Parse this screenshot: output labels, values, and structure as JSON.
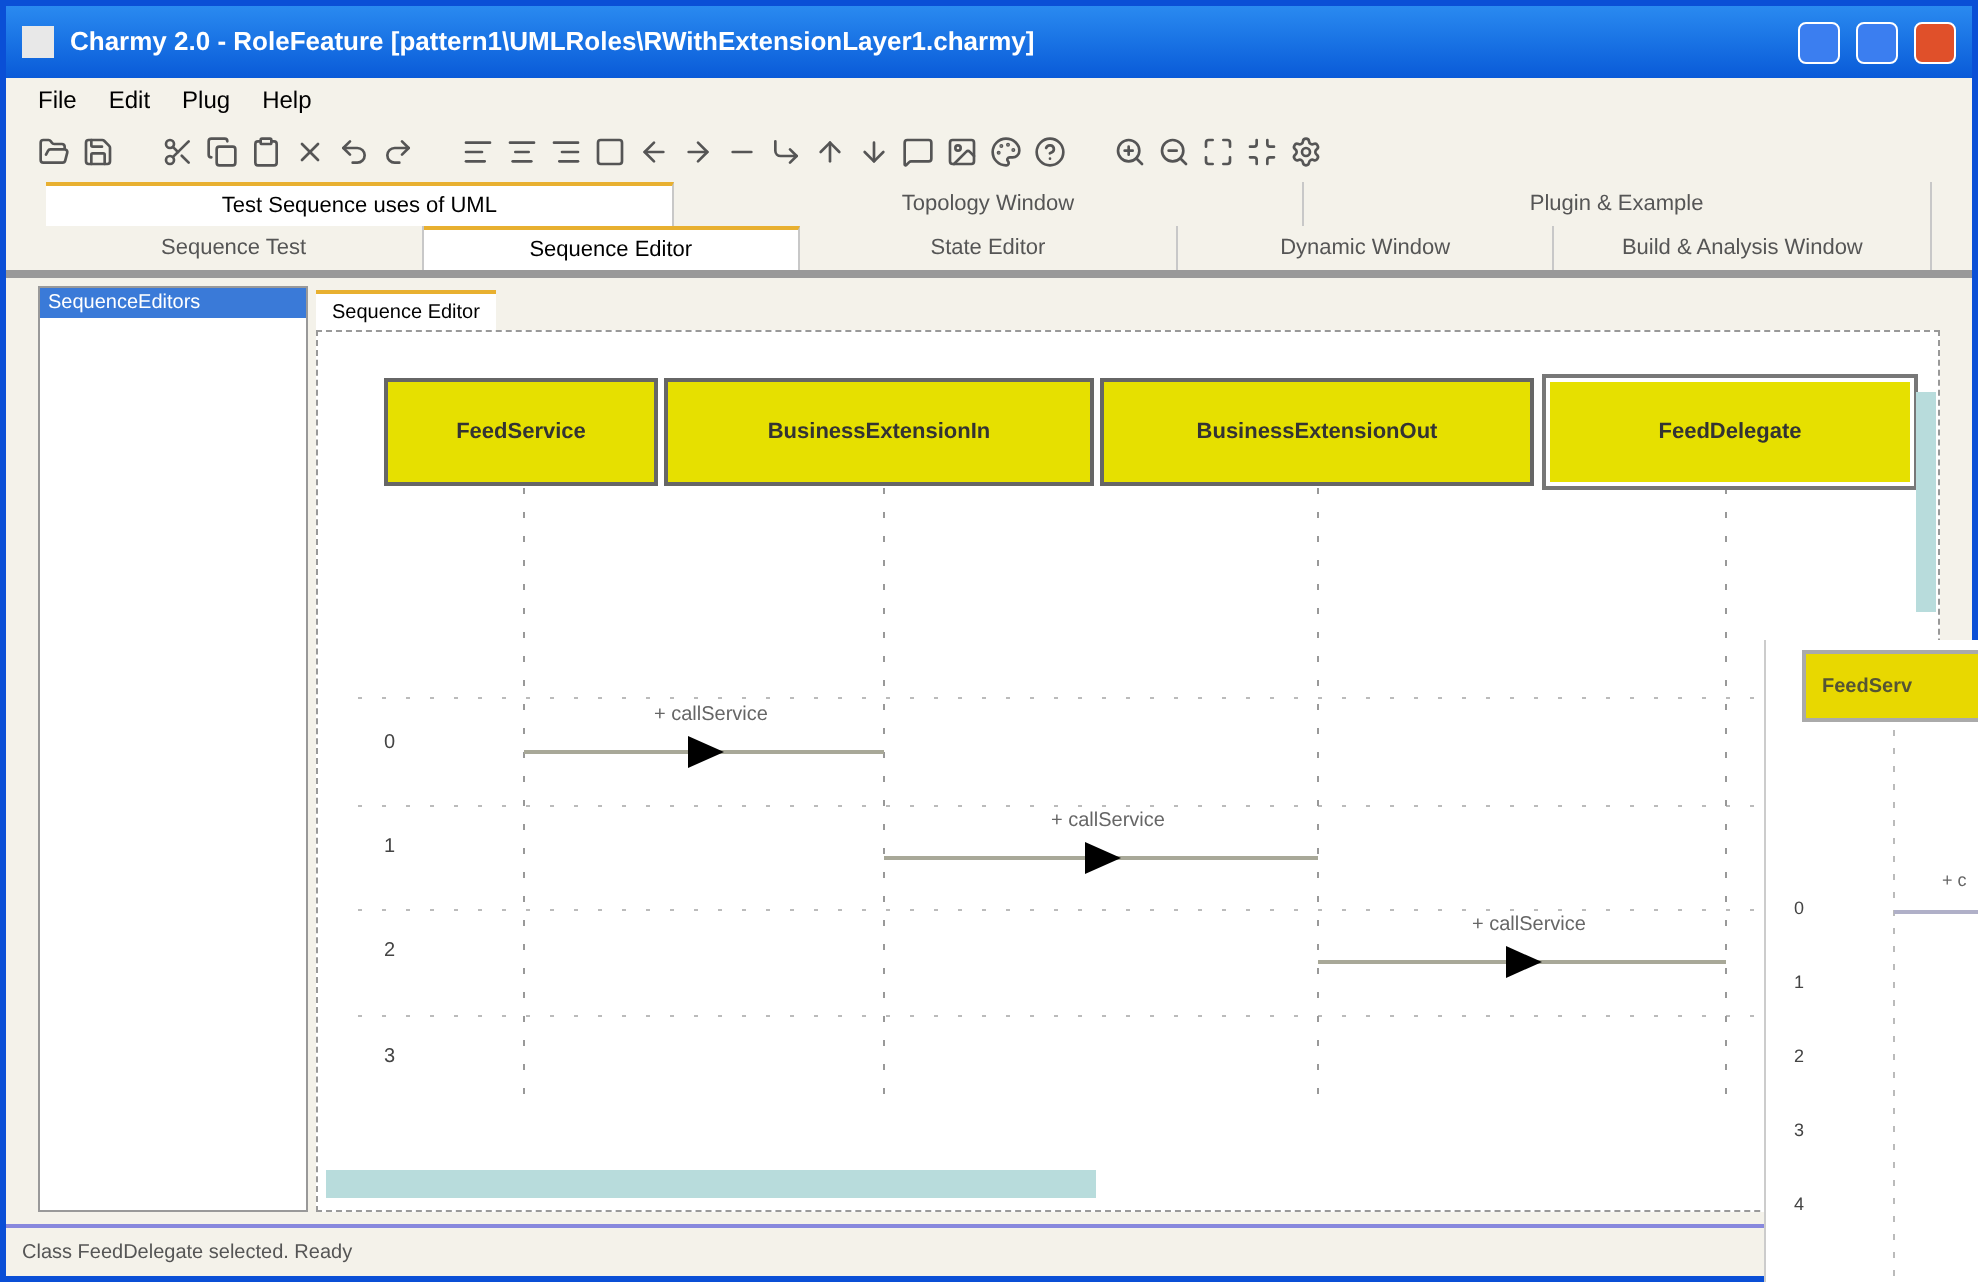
{
  "window": {
    "title": "Charmy 2.0 - RoleFeature [pattern1\\UMLRoles\\RWithExtensionLayer1.charmy]"
  },
  "menu": [
    "File",
    "Edit",
    "Plug",
    "Help"
  ],
  "tab_rows": [
    [
      {
        "label": "Test Sequence uses of UML",
        "selected": true
      },
      {
        "label": "Topology Window",
        "selected": false
      },
      {
        "label": "Plugin & Example",
        "selected": false
      }
    ],
    [
      {
        "label": "Sequence Test",
        "selected": false
      },
      {
        "label": "Sequence Editor",
        "selected": true
      },
      {
        "label": "State Editor",
        "selected": false
      },
      {
        "label": "Dynamic Window",
        "selected": false
      },
      {
        "label": "Build & Analysis Window",
        "selected": false
      }
    ]
  ],
  "left_panel": {
    "items": [
      {
        "label": "SequenceEditors",
        "selected": true
      }
    ]
  },
  "editor": {
    "tabs": [
      {
        "label": "Sequence Editor",
        "selected": true
      }
    ],
    "lifelines": [
      {
        "name": "FeedService",
        "selected": false
      },
      {
        "name": "BusinessExtensionIn",
        "selected": false
      },
      {
        "name": "BusinessExtensionOut",
        "selected": false
      },
      {
        "name": "FeedDelegate",
        "selected": true
      }
    ],
    "rows": [
      "0",
      "1",
      "2",
      "3"
    ],
    "messages": [
      {
        "label": "+ callService"
      },
      {
        "label": "+ callService"
      },
      {
        "label": "+ callService"
      }
    ]
  },
  "second_window": {
    "lifelines": [
      "FeedServ"
    ],
    "rows": [
      "0",
      "1",
      "2",
      "3",
      "4"
    ],
    "messages": [
      {
        "label": "+ c"
      }
    ]
  },
  "status_bar": "Class FeedDelegate selected. Ready"
}
